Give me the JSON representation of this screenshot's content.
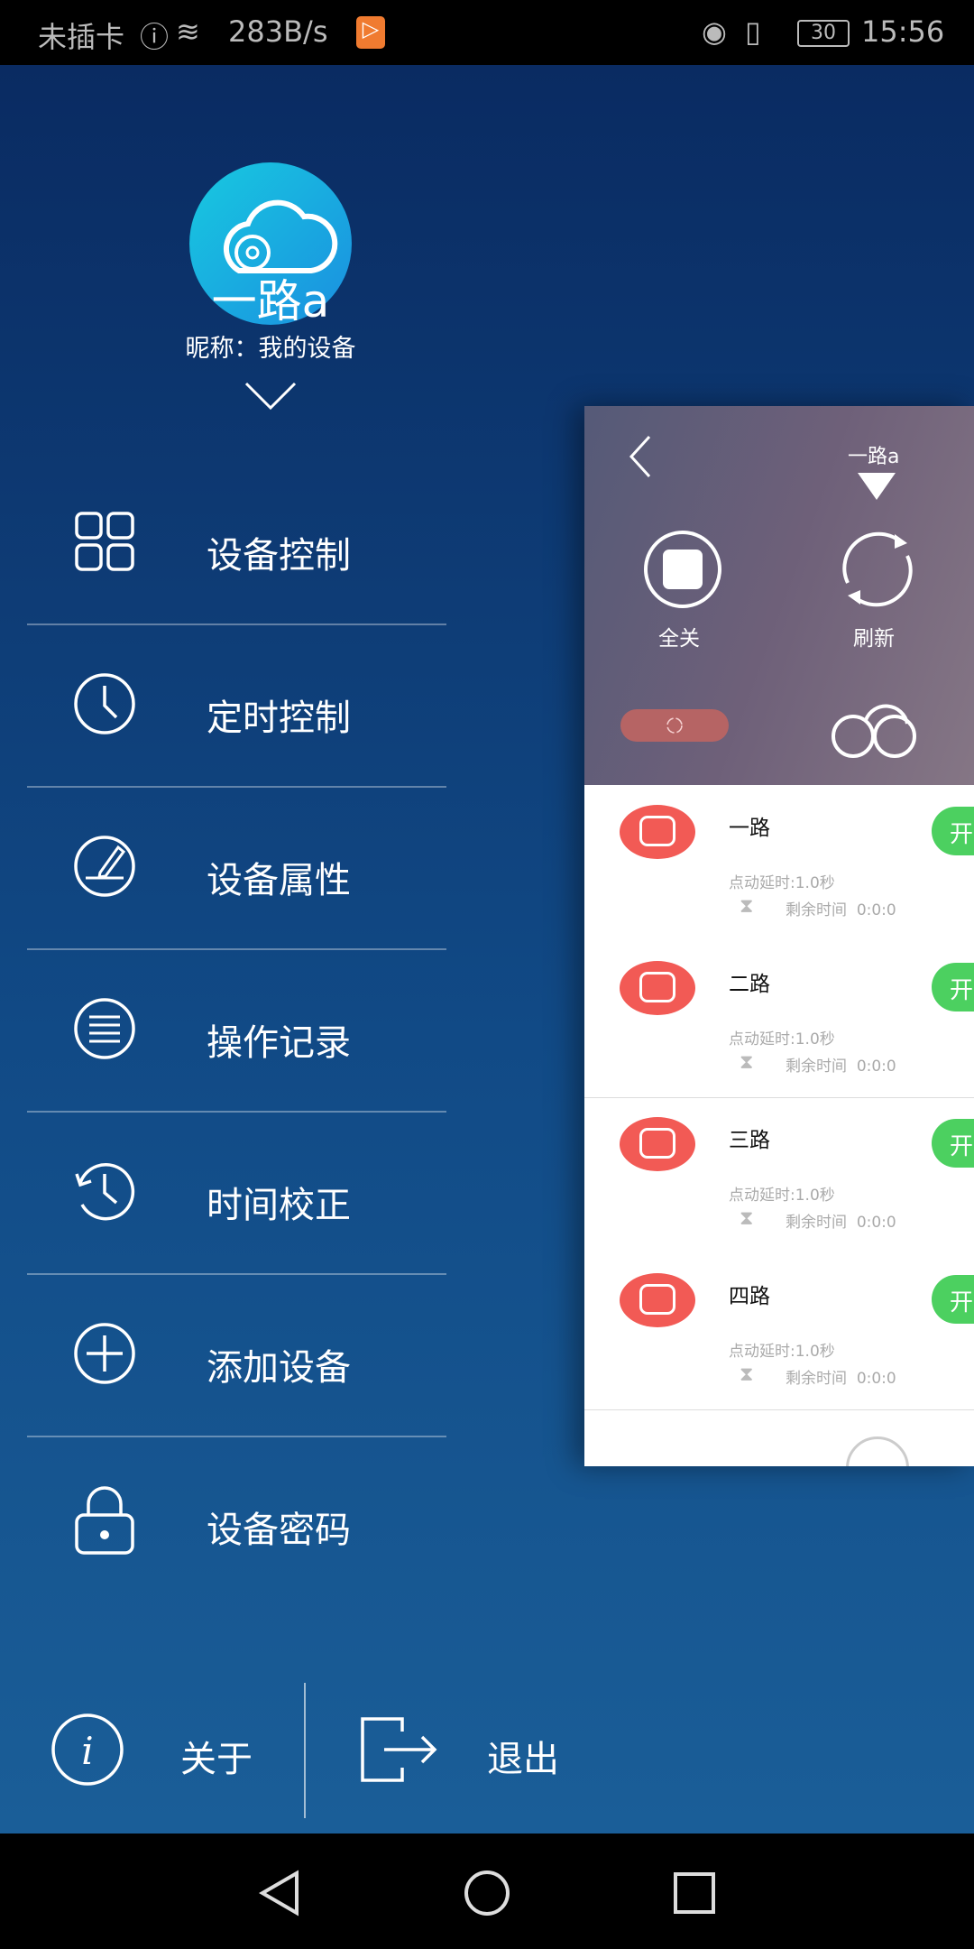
{
  "status_bar": {
    "carrier": "未插卡",
    "speed": "283B/s",
    "battery": "30",
    "time": "15:56"
  },
  "device": {
    "name": "一路a",
    "nickname": "昵称：我的设备"
  },
  "menu": [
    {
      "label": "设备控制",
      "icon": "grid-icon"
    },
    {
      "label": "定时控制",
      "icon": "clock-icon"
    },
    {
      "label": "设备属性",
      "icon": "edit-icon"
    },
    {
      "label": "操作记录",
      "icon": "list-icon"
    },
    {
      "label": "时间校正",
      "icon": "history-icon"
    },
    {
      "label": "添加设备",
      "icon": "plus-icon"
    },
    {
      "label": "设备密码",
      "icon": "lock-icon"
    }
  ],
  "footer": {
    "about": "关于",
    "logout": "退出"
  },
  "panel": {
    "device_name": "一路a",
    "all_off": "全关",
    "refresh": "刷新",
    "channels": [
      {
        "name": "一路",
        "delay": "点动延时:1.0秒",
        "remaining_label": "剩余时间",
        "remaining": "0:0:0",
        "on_label": "开"
      },
      {
        "name": "二路",
        "delay": "点动延时:1.0秒",
        "remaining_label": "剩余时间",
        "remaining": "0:0:0",
        "on_label": "开"
      },
      {
        "name": "三路",
        "delay": "点动延时:1.0秒",
        "remaining_label": "剩余时间",
        "remaining": "0:0:0",
        "on_label": "开"
      },
      {
        "name": "四路",
        "delay": "点动延时:1.0秒",
        "remaining_label": "剩余时间",
        "remaining": "0:0:0",
        "on_label": "开"
      }
    ]
  },
  "colors": {
    "off_button": "#f25a55",
    "on_button": "#4cd060",
    "bg_top": "#0a2b62",
    "bg_bottom": "#1a5e98"
  }
}
